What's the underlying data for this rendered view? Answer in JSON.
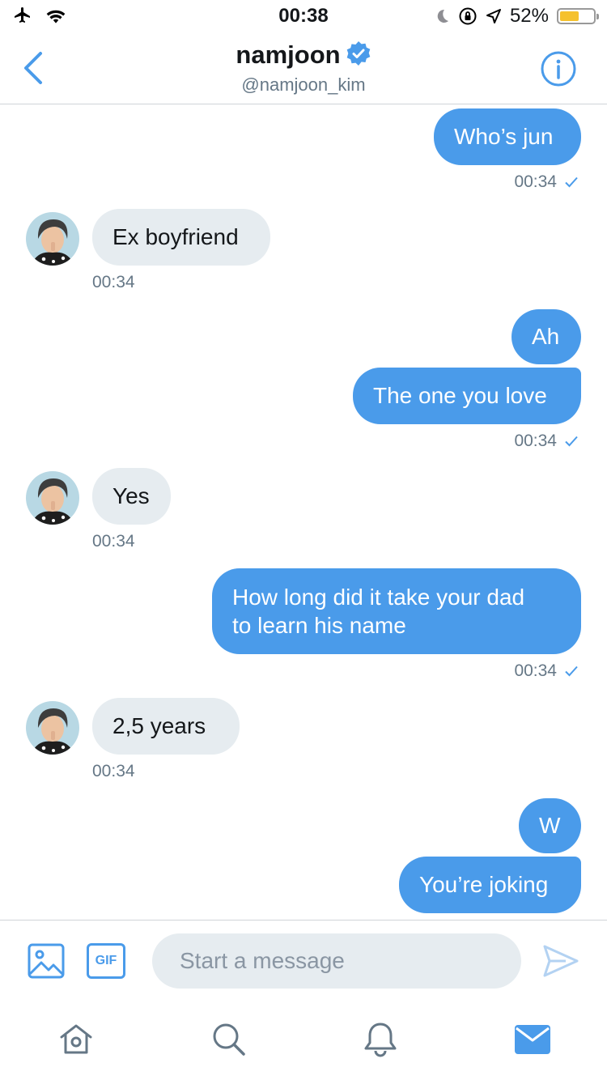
{
  "status_bar": {
    "time": "00:38",
    "battery": "52%"
  },
  "header": {
    "name": "namjoon",
    "handle": "@namjoon_kim"
  },
  "messages": [
    {
      "text": "Who’s jun"
    },
    {
      "text": "Ex boyfriend"
    },
    {
      "text": "Ah"
    },
    {
      "text": "The one you love"
    },
    {
      "text": "Yes"
    },
    {
      "text_line1": "How long did it take your dad",
      "text_line2": "to learn his name"
    },
    {
      "text": "2,5 years"
    },
    {
      "text": "W"
    },
    {
      "text": "You’re joking"
    }
  ],
  "timestamps": [
    "00:34",
    "00:34",
    "00:34",
    "00:34",
    "00:34",
    "00:34",
    "00:34"
  ],
  "composer": {
    "placeholder": "Start a message",
    "gif_label": "GIF"
  },
  "tabs": [
    "home",
    "search",
    "notifications",
    "messages"
  ],
  "colors": {
    "accent": "#4a9bea",
    "received_bubble": "#e6ecf0",
    "muted_text": "#657786"
  }
}
